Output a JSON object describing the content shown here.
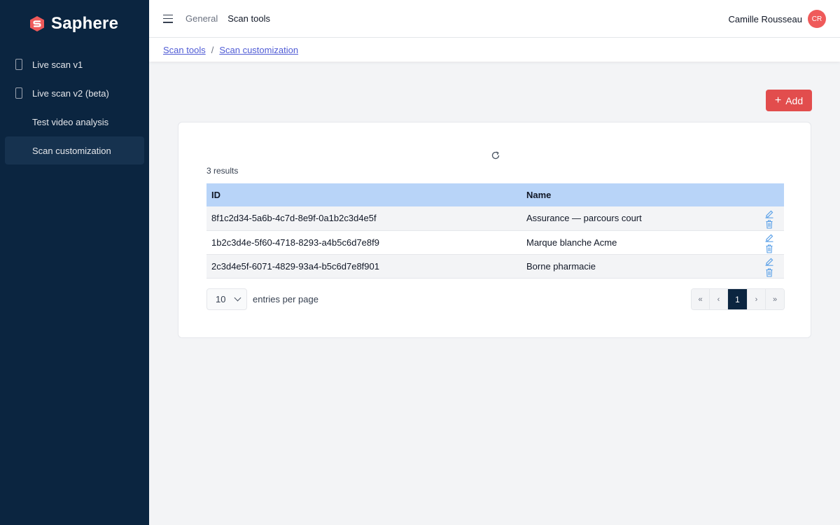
{
  "app": {
    "brand": "Saphere"
  },
  "sidebar": {
    "items": [
      {
        "label": "Live scan v1",
        "icon": "phone-icon"
      },
      {
        "label": "Live scan v2 (beta)",
        "icon": "phone-icon"
      },
      {
        "label": "Test video analysis",
        "icon": ""
      },
      {
        "label": "Scan customization",
        "icon": "",
        "active": true
      }
    ]
  },
  "topbar": {
    "menu_icon": "hamburger-icon",
    "links": [
      "General",
      "Scan tools"
    ],
    "user": {
      "name": "Camille Rousseau",
      "initials": "CR"
    }
  },
  "breadcrumb": [
    "Scan tools",
    "Scan customization"
  ],
  "toolbar": {
    "add_label": "Add",
    "refresh_icon": "refresh-icon"
  },
  "table": {
    "results_text": "3 results",
    "columns": [
      "ID",
      "Name"
    ],
    "rows": [
      {
        "id": "8f1c2d34-5a6b-4c7d-8e9f-0a1b2c3d4e5f",
        "name": "Assurance — parcours court"
      },
      {
        "id": "1b2c3d4e-5f60-4718-8293-a4b5c6d7e8f9",
        "name": "Marque blanche Acme"
      },
      {
        "id": "2c3d4e5f-6071-4829-93a4-b5c6d7e8f901",
        "name": "Borne pharmacie"
      }
    ],
    "row_actions": [
      "edit-icon",
      "trash-icon"
    ]
  },
  "pagination": {
    "per_page_value": "10",
    "per_page_label": "entries per page",
    "buttons": [
      "«",
      "‹",
      "1",
      "›",
      "»"
    ],
    "current_page": "1"
  },
  "colors": {
    "sidebar_bg": "#0b2540",
    "accent_red": "#e24d4d",
    "table_header": "#b8d4f8",
    "link": "#4f5bd5"
  }
}
